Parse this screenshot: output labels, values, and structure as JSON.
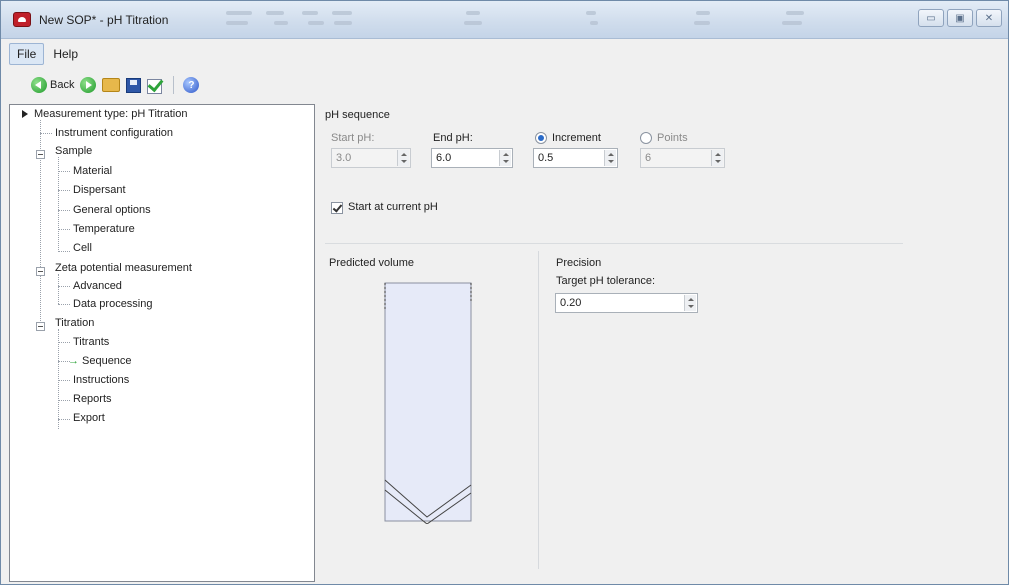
{
  "window": {
    "title": "New SOP* - pH Titration",
    "caption_buttons": [
      "minimize",
      "restore",
      "close"
    ]
  },
  "menu": {
    "file": "File",
    "help": "Help"
  },
  "toolbar": {
    "back_label": "Back"
  },
  "tree": {
    "root": "Measurement type: pH Titration",
    "instrument_config": "Instrument configuration",
    "sample": "Sample",
    "material": "Material",
    "dispersant": "Dispersant",
    "general_options": "General options",
    "temperature": "Temperature",
    "cell": "Cell",
    "zeta": "Zeta potential measurement",
    "advanced": "Advanced",
    "data_processing": "Data processing",
    "titration": "Titration",
    "titrants": "Titrants",
    "sequence": "Sequence",
    "instructions": "Instructions",
    "reports": "Reports",
    "export": "Export",
    "selected": "Sequence"
  },
  "ph_sequence": {
    "heading": "pH sequence",
    "start_label": "Start pH:",
    "start_value": "3.0",
    "end_label": "End pH:",
    "end_value": "6.0",
    "increment_label": "Increment",
    "increment_value": "0.5",
    "points_label": "Points",
    "points_value": "6",
    "mode": "Increment",
    "start_current_label": "Start at current pH",
    "start_current_checked": true
  },
  "predicted_volume": {
    "label": "Predicted volume"
  },
  "precision": {
    "heading": "Precision",
    "tolerance_label": "Target pH tolerance:",
    "tolerance_value": "0.20"
  },
  "colors": {
    "vessel_fill": "#e6eaf8",
    "accent": "#2a6bc9"
  }
}
